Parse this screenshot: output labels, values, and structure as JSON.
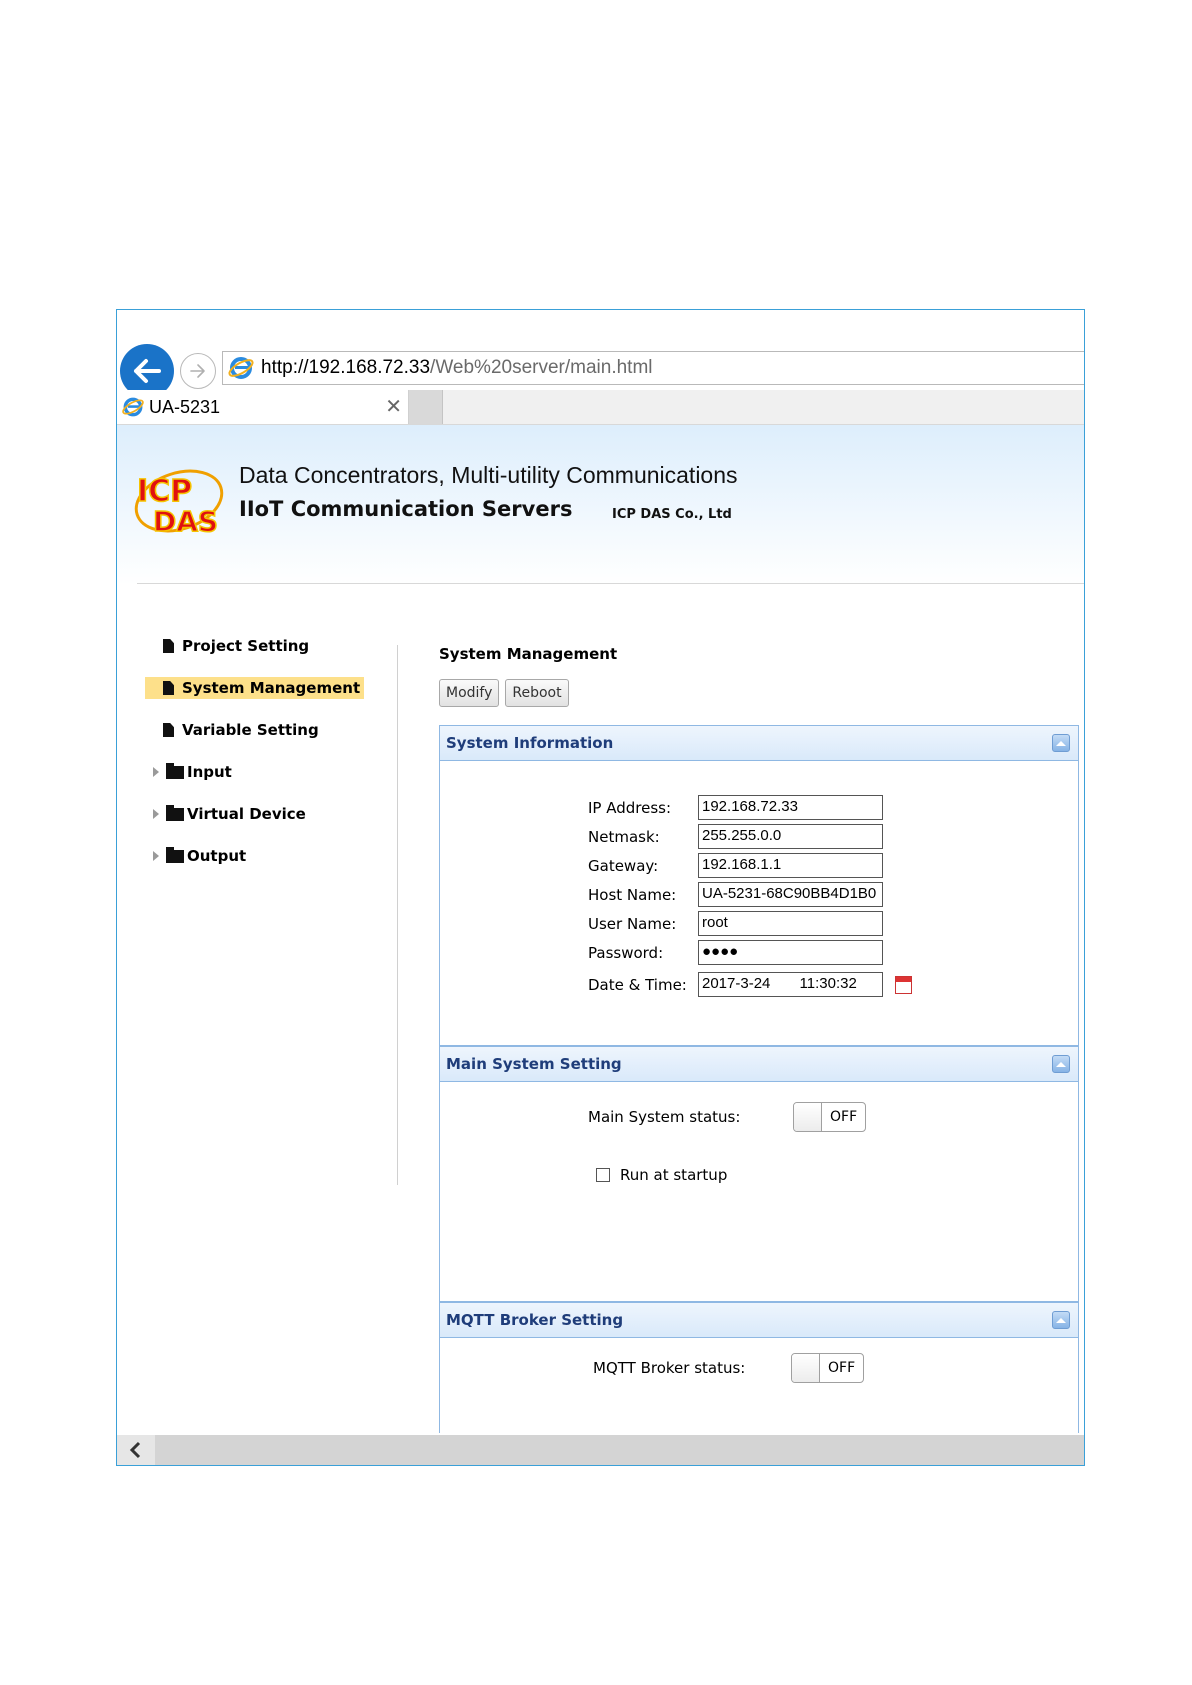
{
  "browser": {
    "url_host": "http://192.168.72.33",
    "url_path": "/Web%20server/main.html",
    "tab_title": "UA-5231",
    "tab_close": "✕"
  },
  "header": {
    "logo_text": "ICP DAS",
    "line1": "Data Concentrators, Multi-utility Communications",
    "line2": "IIoT Communication Servers",
    "company": "ICP DAS Co., Ltd"
  },
  "sidebar": {
    "items": [
      {
        "label": "Project Setting",
        "type": "doc",
        "active": false
      },
      {
        "label": "System Management",
        "type": "doc",
        "active": true
      },
      {
        "label": "Variable Setting",
        "type": "doc",
        "active": false
      },
      {
        "label": "Input",
        "type": "folder",
        "active": false
      },
      {
        "label": "Virtual Device",
        "type": "folder",
        "active": false
      },
      {
        "label": "Output",
        "type": "folder",
        "active": false
      }
    ]
  },
  "main": {
    "title": "System Management",
    "buttons": {
      "modify": "Modify",
      "reboot": "Reboot"
    },
    "system_info": {
      "header": "System Information",
      "fields": [
        {
          "label": "IP Address:",
          "value": "192.168.72.33"
        },
        {
          "label": "Netmask:",
          "value": "255.255.0.0"
        },
        {
          "label": "Gateway:",
          "value": "192.168.1.1"
        },
        {
          "label": "Host Name:",
          "value": "UA-5231-68C90BB4D1B0"
        },
        {
          "label": "User Name:",
          "value": "root"
        },
        {
          "label": "Password:",
          "value": "●●●●"
        },
        {
          "label": "Date & Time:",
          "value": "2017-3-24       11:30:32"
        }
      ]
    },
    "main_system": {
      "header": "Main System Setting",
      "status_label": "Main System status:",
      "toggle": "OFF",
      "checkbox_label": "Run at startup"
    },
    "mqtt": {
      "header": "MQTT Broker Setting",
      "status_label": "MQTT Broker status:",
      "toggle": "OFF"
    }
  },
  "colors": {
    "accent": "#1a73c8",
    "active_highlight": "#fde08a",
    "panel_header_text": "#1f3d7a"
  }
}
